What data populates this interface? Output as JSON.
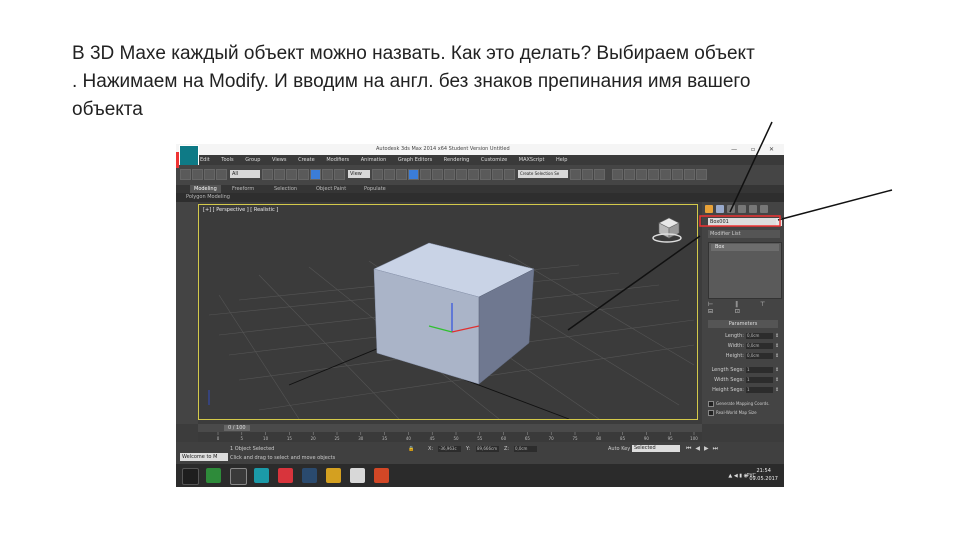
{
  "caption": {
    "line1": "В 3D Maxe каждый объект можно назвать. Как это делать? Выбираем объект",
    "line2": ". Нажимаем на Modify. И вводим на англ. без знаков препинания имя вашего",
    "line3": "объекта"
  },
  "window": {
    "title": "Autodesk 3ds Max 2014 x64    Student Version    Untitled",
    "controls": "— ▫ ✕"
  },
  "menu": [
    "Edit",
    "Tools",
    "Group",
    "Views",
    "Create",
    "Modifiers",
    "Animation",
    "Graph Editors",
    "Rendering",
    "Customize",
    "MAXScript",
    "Help"
  ],
  "toolbar": {
    "selection_filter": "All",
    "named_selection": "Create Selection Se",
    "view_dropdown": "View"
  },
  "ribbon": {
    "tabs": [
      "Modeling",
      "Freeform",
      "Selection",
      "Object Paint",
      "Populate"
    ],
    "active_tab": "Modeling",
    "sub": "Polygon Modeling"
  },
  "viewport": {
    "label": "[+] [ Perspective ] [ Realistic ]"
  },
  "command_panel": {
    "object_name": "Box001",
    "modifier_list": "Modifier List",
    "stack_item": "Box",
    "stack_buttons": "⊢ ‖ ⊤ ⊟ ⊡",
    "rollout_title": "Parameters",
    "params": [
      {
        "label": "Length:",
        "value": "0,0cm"
      },
      {
        "label": "Width:",
        "value": "0,0cm"
      },
      {
        "label": "Height:",
        "value": "0,0cm"
      },
      {
        "label": "Length Segs:",
        "value": "1"
      },
      {
        "label": "Width Segs:",
        "value": "1"
      },
      {
        "label": "Height Segs:",
        "value": "1"
      }
    ],
    "checkboxes": [
      "Generate Mapping Coords.",
      "Real-World Map Size"
    ]
  },
  "timeline": {
    "frame_label": "0 / 100",
    "ticks": [
      "0",
      "5",
      "10",
      "15",
      "20",
      "25",
      "30",
      "35",
      "40",
      "45",
      "50",
      "55",
      "60",
      "65",
      "70",
      "75",
      "80",
      "85",
      "90",
      "95",
      "100"
    ]
  },
  "status": {
    "maxscript": "Welcome to M",
    "line1": "1 Object Selected",
    "line2": "Click and drag to select and move objects",
    "x_value": "-36,963c",
    "y_value": "89,666cm",
    "z_value": "0,0cm",
    "autokey_label": "Auto Key",
    "autokey_value": "Selected"
  },
  "taskbar": {
    "time": "21:54",
    "date": "09.05.2017",
    "lang": "РУС",
    "tray_icons": "▲ ◀ ▮ ◉"
  },
  "colors": {
    "viewport_border": "#d3c94a",
    "gizmo_x": "#e03030",
    "gizmo_y": "#30c030",
    "gizmo_z": "#3050e0",
    "annotation_arrow": "#111111",
    "highlight": "#e33333"
  }
}
